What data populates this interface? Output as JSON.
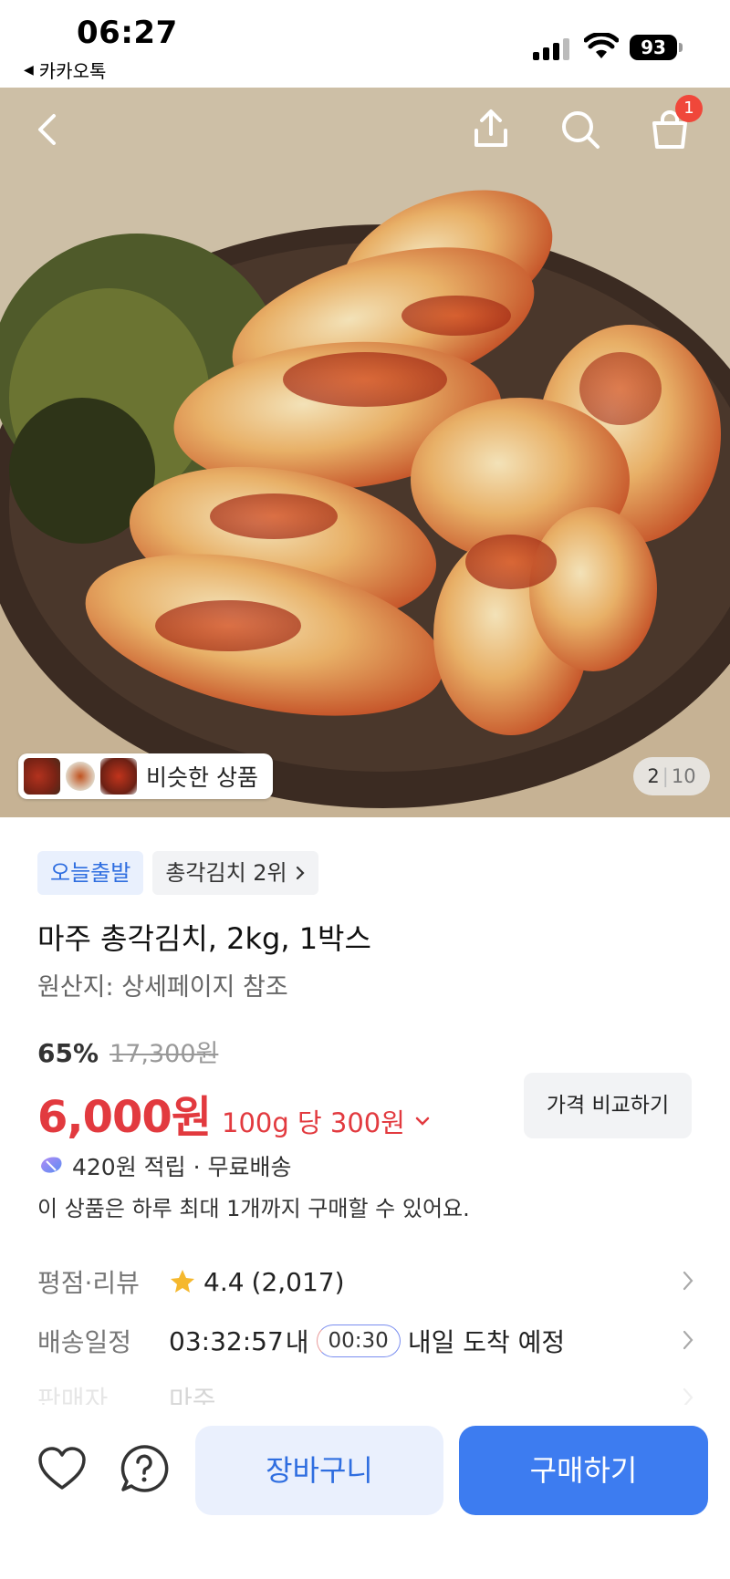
{
  "status_bar": {
    "time": "06:27",
    "back_app_label": "카카오톡",
    "battery": "93"
  },
  "nav": {
    "cart_badge": "1"
  },
  "gallery": {
    "similar_label": "비슷한 상품",
    "current_page": "2",
    "separator": "|",
    "total_pages": "10"
  },
  "product": {
    "tags": [
      "오늘출발",
      "총각김치 2위"
    ],
    "title": "마주 총각김치, 2kg, 1박스",
    "origin": "원산지: 상세페이지 참조",
    "discount": "65%",
    "original_price": "17,300원",
    "price": "6,000원",
    "unit_price": "100g 당 300원",
    "compare_label": "가격 비교하기",
    "points_text": "420원 적립 · 무료배송",
    "limit_text": "이 상품은 하루 최대 1개까지 구매할 수 있어요."
  },
  "info_rows": {
    "rating_label": "평점·리뷰",
    "rating_value": "4.4",
    "review_count": "(2,017)",
    "delivery_label": "배송일정",
    "delivery_countdown": "03:32:57",
    "delivery_within": "내",
    "delivery_timer": "00:30",
    "delivery_text": "내일 도착 예정",
    "seller_label": "판매자",
    "seller_value": "마주"
  },
  "bottom_bar": {
    "cart_label": "장바구니",
    "buy_label": "구매하기"
  },
  "colors": {
    "accent_blue": "#3d7cf0",
    "price_red": "#e23a3f",
    "badge_red": "#f0473a",
    "star_yellow": "#f5b82e"
  },
  "icons": [
    "back-arrow-icon",
    "share-icon",
    "search-icon",
    "cart-icon",
    "chevron-right-icon",
    "chevron-down-icon",
    "star-icon",
    "points-icon",
    "heart-icon",
    "question-icon"
  ]
}
